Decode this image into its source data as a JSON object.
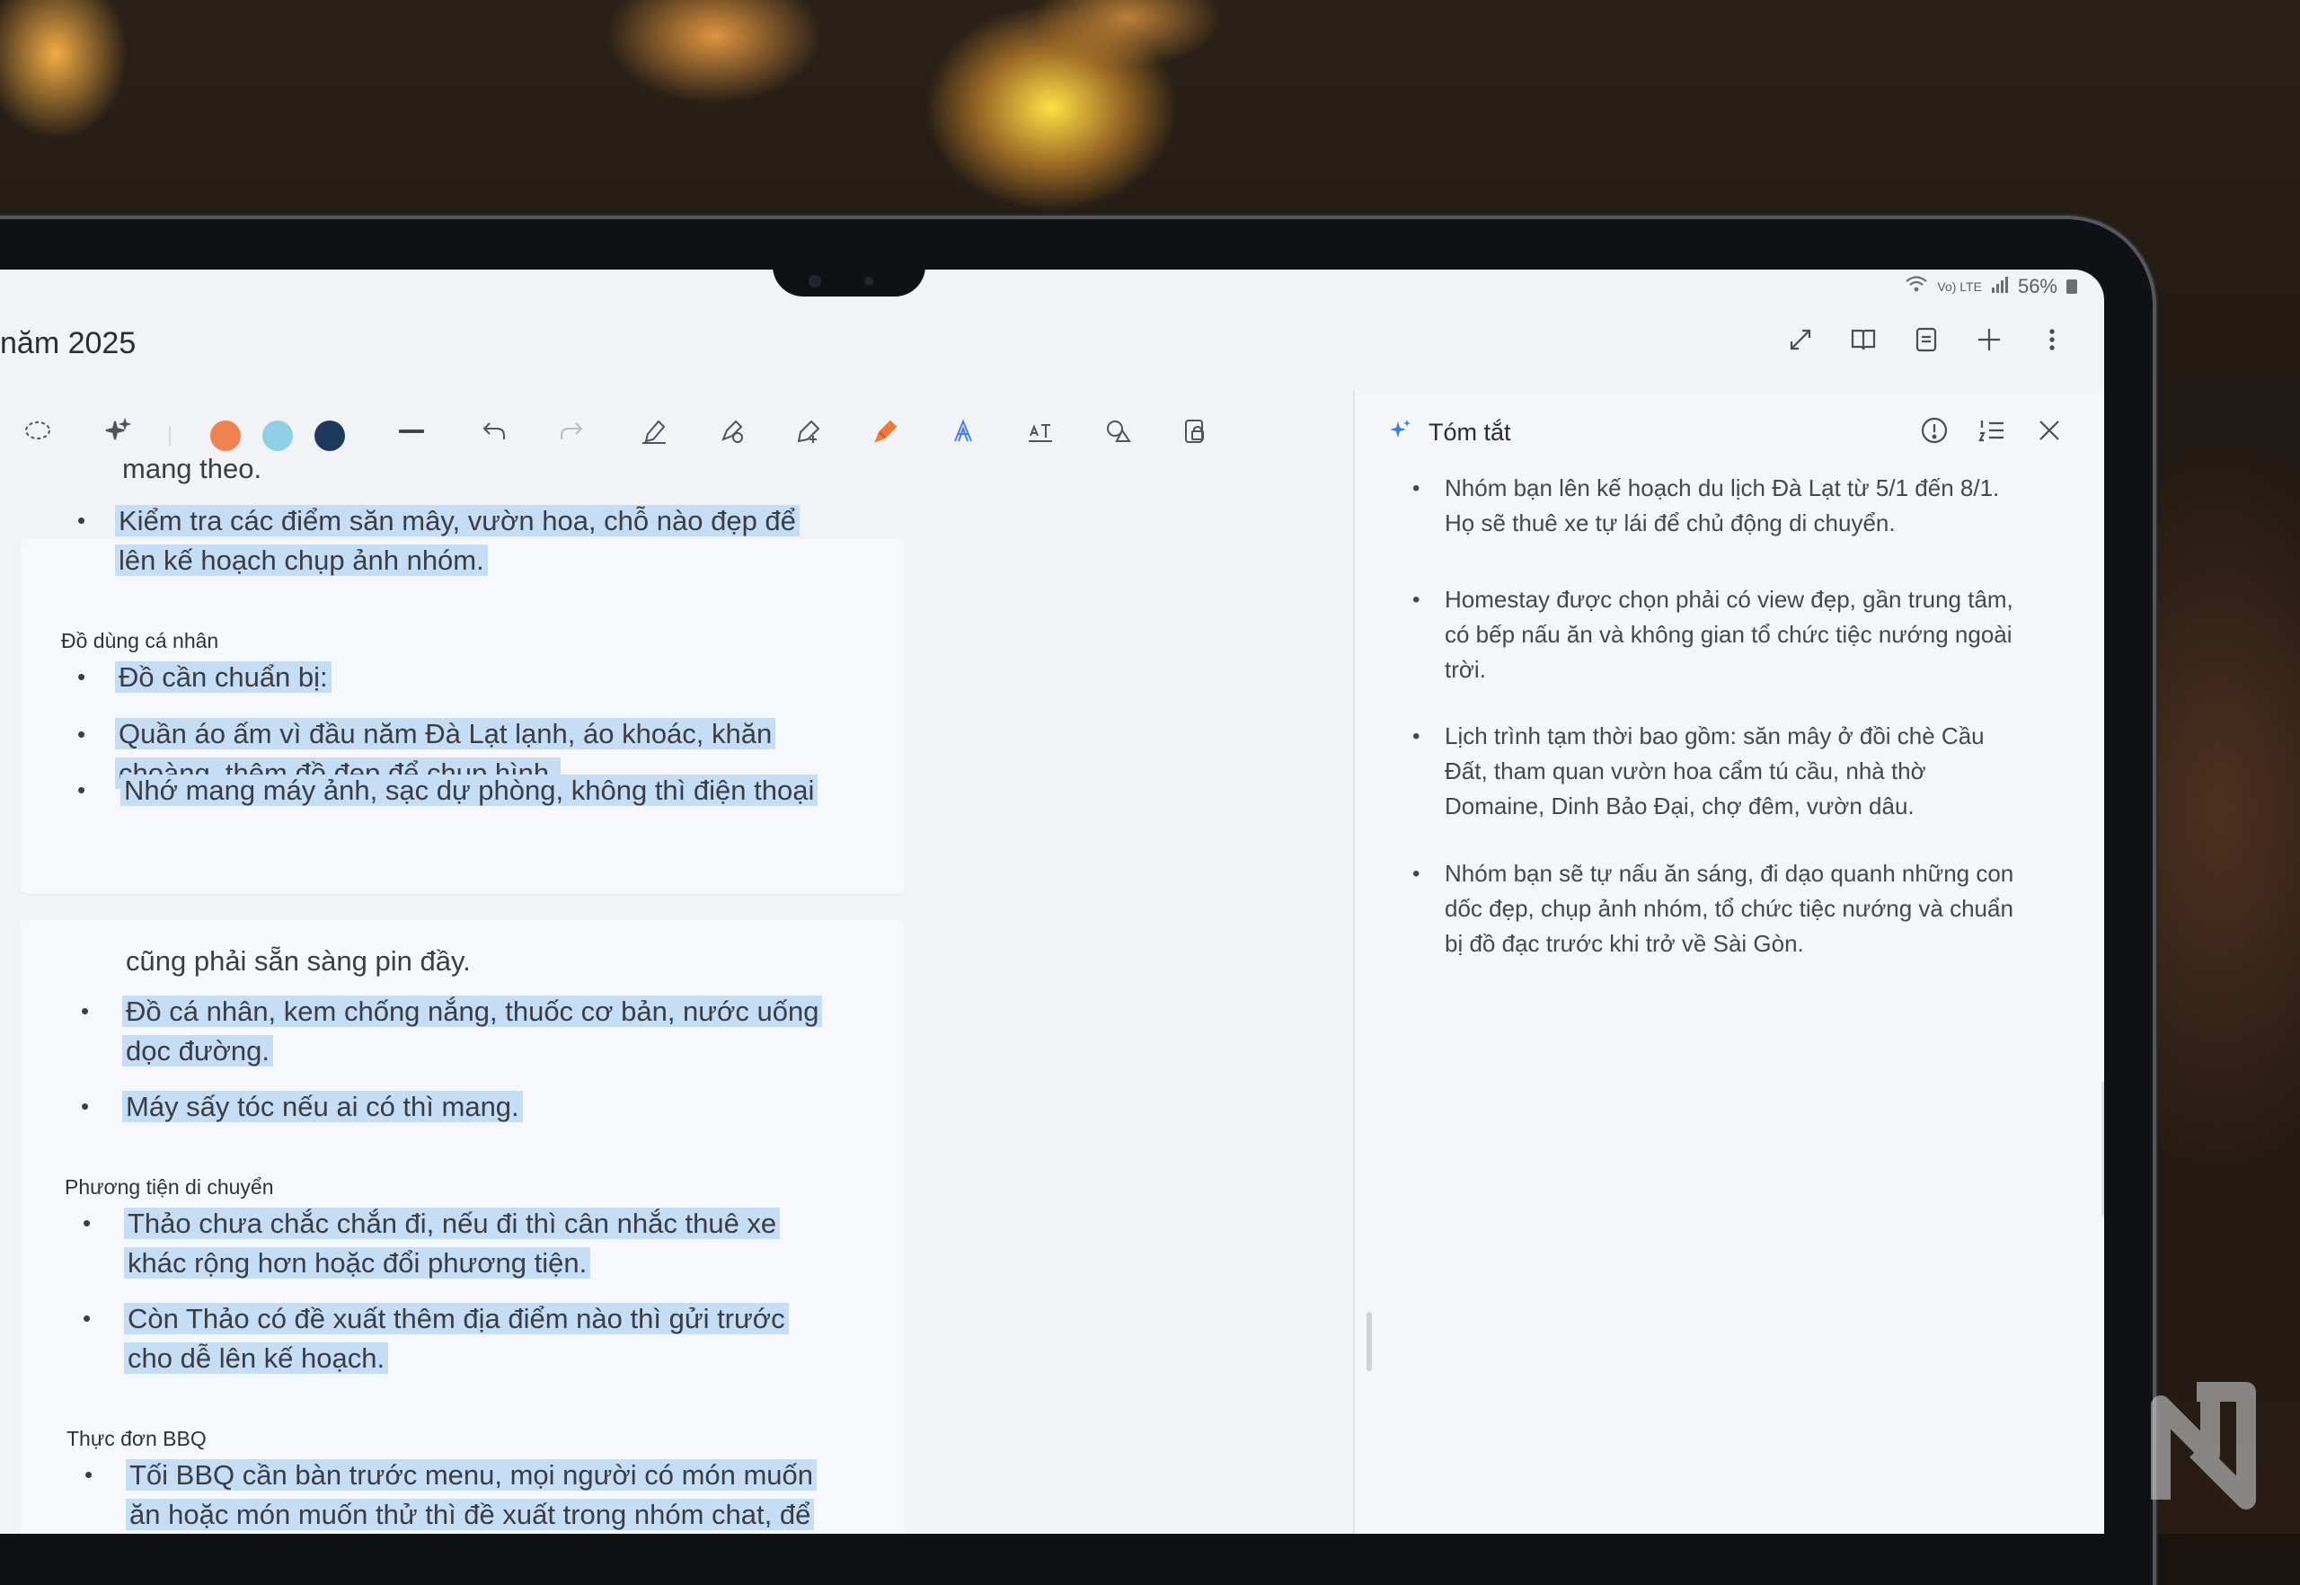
{
  "status_bar": {
    "network": "Vo) LTE",
    "battery": "56%"
  },
  "header": {
    "title": "năm 2025"
  },
  "toolbar": {
    "colors": [
      "#f08252",
      "#8fd0e6",
      "#1d3a5c"
    ],
    "icons": [
      "lasso-icon",
      "ai-sparkle-icon",
      "pen-thickness-icon",
      "undo-icon",
      "redo-icon",
      "pen-icon",
      "highlighter-pen-icon",
      "shape-pen-icon",
      "highlighter-icon",
      "text-style-icon",
      "text-box-icon",
      "shapes-icon",
      "lock-page-icon"
    ]
  },
  "note": {
    "page1": {
      "continuation": "mang theo.",
      "bullet1_line1": "Kiểm tra các điểm săn mây, vườn hoa, chỗ nào đẹp để",
      "bullet1_line2": "lên kế hoạch chụp ảnh nhóm.",
      "heading": "Đồ dùng cá nhân",
      "bullet2": "Đồ cần chuẩn bị:",
      "bullet3_line1": "Quần áo ấm vì đầu năm Đà Lạt lạnh, áo khoác, khăn",
      "bullet3_line2": "choàng, thêm đồ đẹp để chụp hình.",
      "bullet4": "Nhớ mang máy ảnh, sạc dự phòng, không thì điện thoại"
    },
    "page2": {
      "continuation": "cũng phải sẵn sàng pin đầy.",
      "bullet1_line1": "Đồ cá nhân, kem chống nắng, thuốc cơ bản, nước uống",
      "bullet1_line2": "dọc đường.",
      "bullet2": "Máy sấy tóc nếu ai có thì mang.",
      "heading2": "Phương tiện di chuyển",
      "bullet3_line1": "Thảo chưa chắc chắn đi, nếu đi thì cân nhắc thuê xe",
      "bullet3_line2": "khác rộng hơn hoặc đổi phương tiện.",
      "bullet4_line1": "Còn Thảo có đề xuất thêm địa điểm nào thì gửi trước",
      "bullet4_line2": "cho dễ lên kế hoạch.",
      "heading3": "Thực đơn BBQ",
      "bullet5_line1": "Tối BBQ cần bàn trước menu, mọi người có món muốn",
      "bullet5_line2": "ăn hoặc món muốn thử thì đề xuất trong nhóm chat, để"
    }
  },
  "summary": {
    "title": "Tóm tắt",
    "items": [
      {
        "l1": "Nhóm bạn lên kế hoạch du lịch Đà Lạt từ 5/1 đến 8/1.",
        "l2": "Họ sẽ thuê xe tự lái để chủ động di chuyển.",
        "l3": ""
      },
      {
        "l1": "Homestay được chọn phải có view đẹp, gần trung tâm,",
        "l2": "có bếp nấu ăn và không gian tổ chức tiệc nướng ngoài",
        "l3": "trời."
      },
      {
        "l1": "Lịch trình tạm thời bao gồm: săn mây ở đồi chè Cầu",
        "l2": "Đất, tham quan vườn hoa cẩm tú cầu, nhà thờ",
        "l3": "Domaine, Dinh Bảo Đại, chợ đêm, vườn dâu."
      },
      {
        "l1": "Nhóm bạn sẽ tự nấu ăn sáng, đi dạo quanh những con",
        "l2": "dốc đẹp, chụp ảnh nhóm, tổ chức tiệc nướng và chuẩn",
        "l3": "bị đồ đạc trước khi trở về Sài Gòn."
      }
    ],
    "bullet": "•"
  }
}
